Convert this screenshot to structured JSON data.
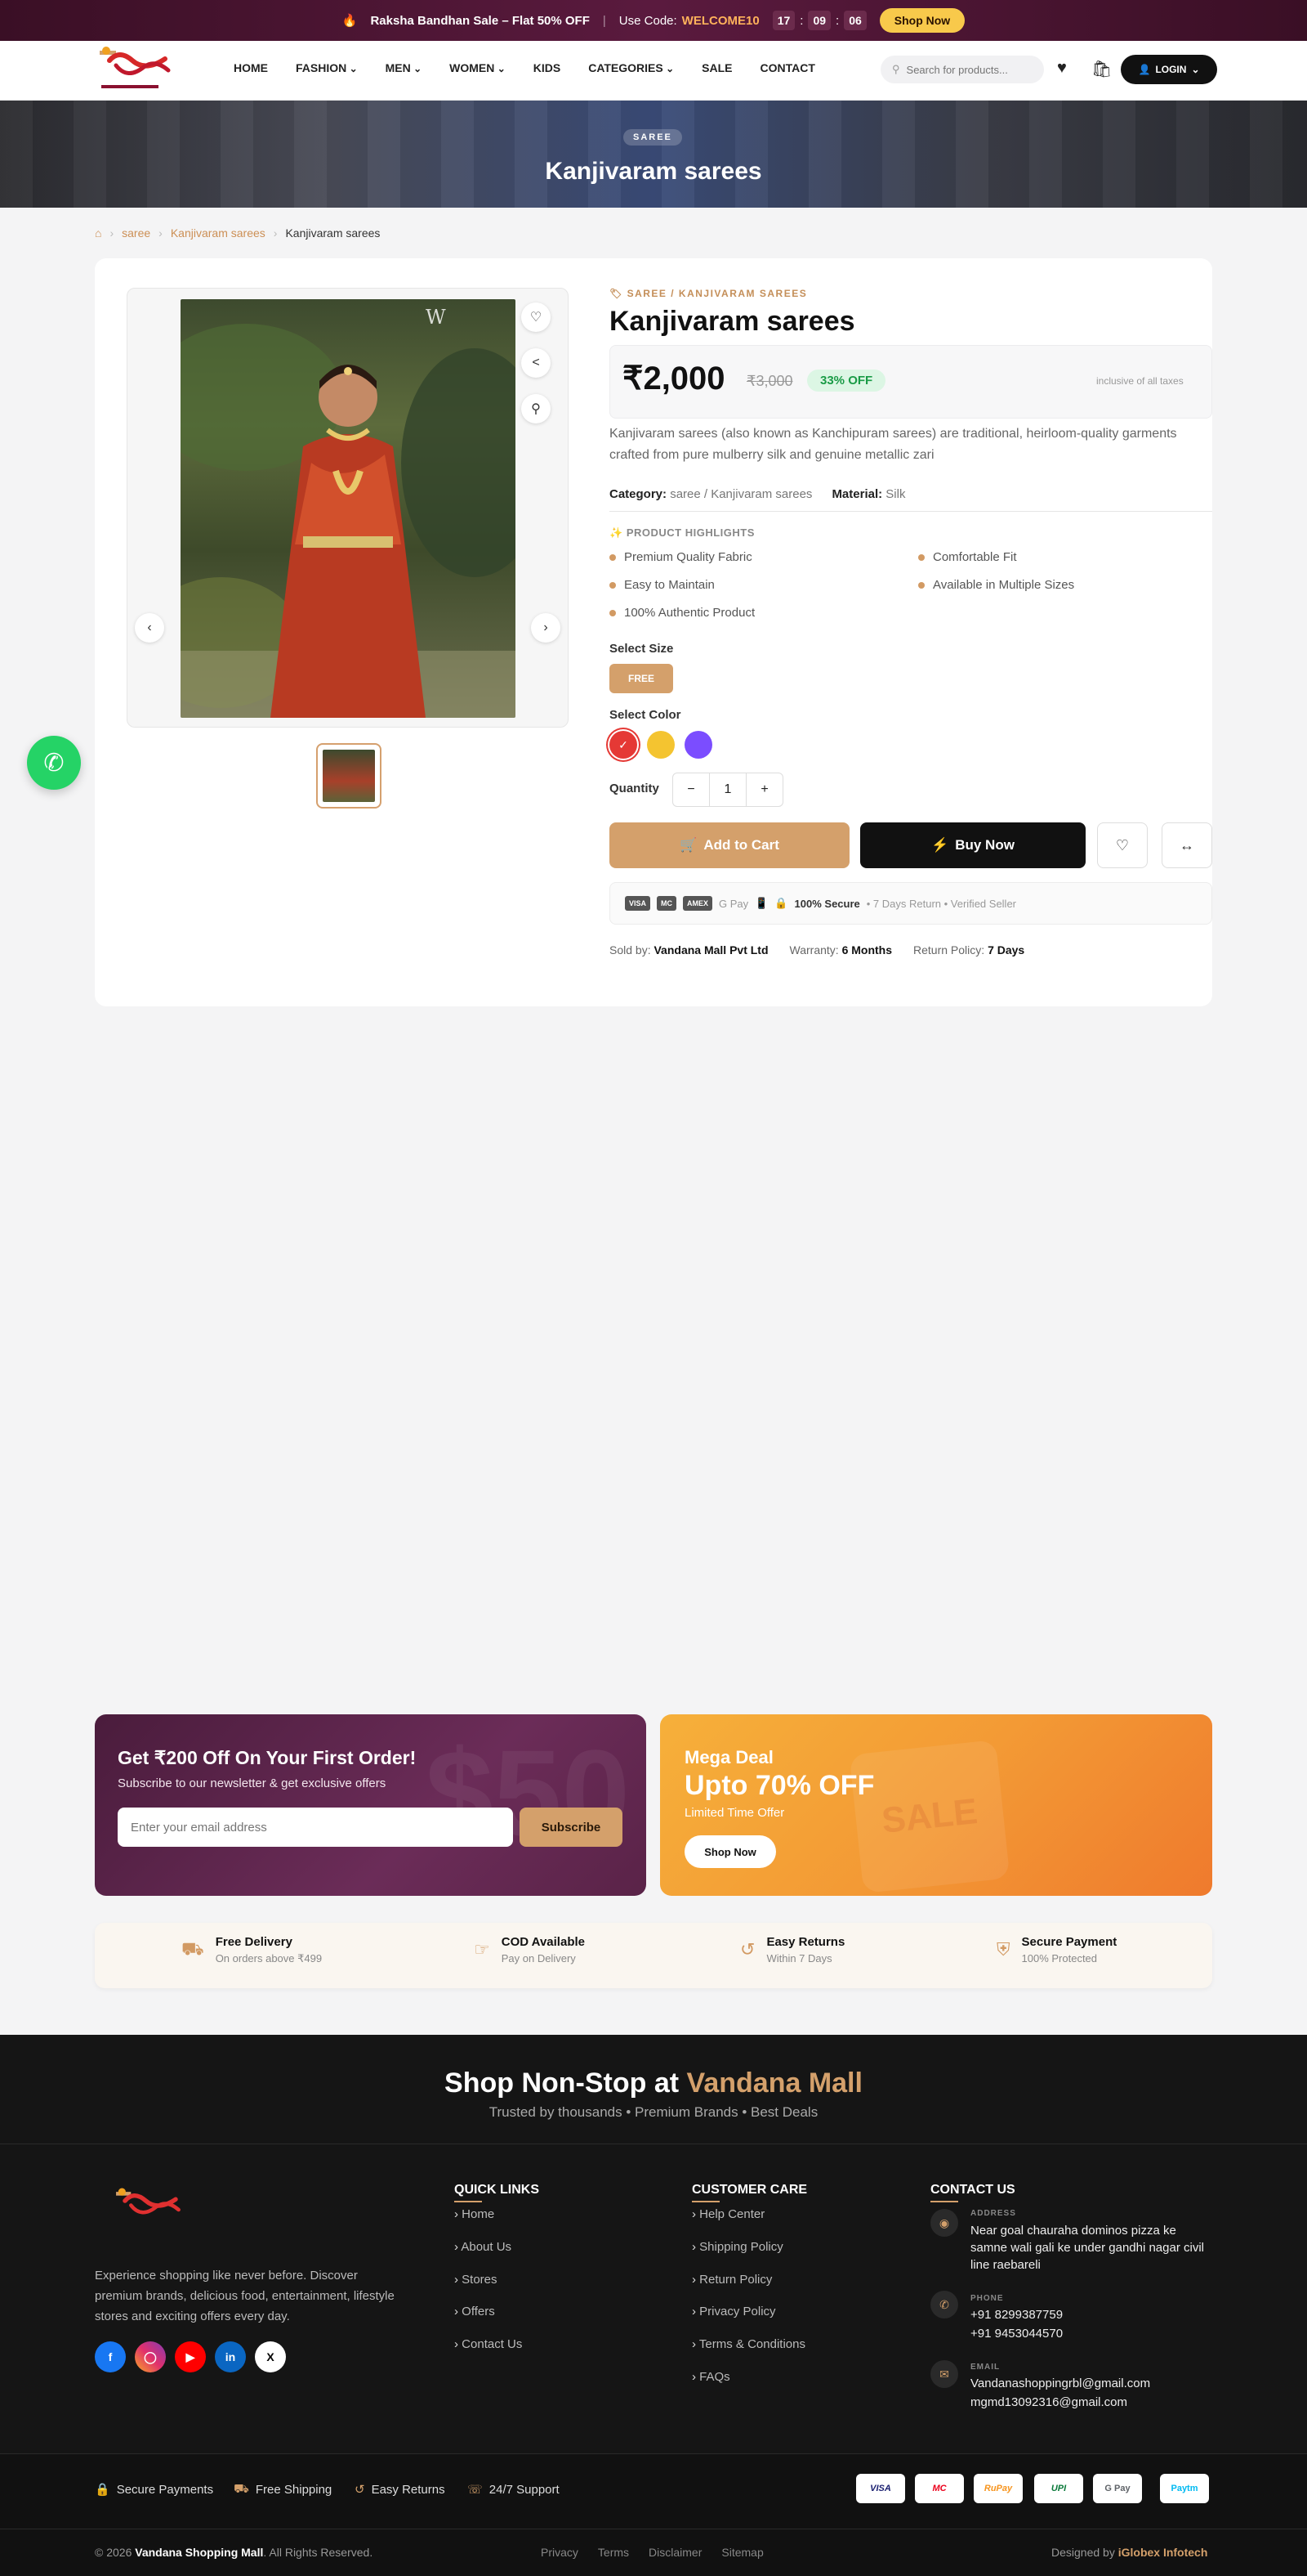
{
  "promo": {
    "text": "Raksha Bandhan Sale – Flat 50% OFF",
    "code_label": "Use Code:",
    "code": "WELCOME10",
    "timer": [
      "17",
      "09",
      "06"
    ],
    "shop_now": "Shop Now"
  },
  "header": {
    "nav": [
      "HOME",
      "FASHION",
      "MEN",
      "WOMEN",
      "KIDS",
      "CATEGORIES",
      "SALE",
      "CONTACT"
    ],
    "search_placeholder": "Search for products...",
    "login": "LOGIN"
  },
  "banner": {
    "tag": "SAREE",
    "title": "Kanjivaram sarees"
  },
  "breadcrumb": [
    "saree",
    "Kanjivaram sarees",
    "Kanjivaram sarees"
  ],
  "product": {
    "category_line": "SAREE / KANJIVARAM SAREES",
    "title": "Kanjivaram sarees",
    "price": "₹2,000",
    "old_price": "₹3,000",
    "discount": "33% OFF",
    "tax_note": "inclusive of all taxes",
    "description": "Kanjivaram sarees (also known as Kanchipuram sarees) are traditional, heirloom-quality garments crafted from pure mulberry silk and genuine metallic zari",
    "category_label": "Category:",
    "category_value": "saree / Kanjivaram sarees",
    "material_label": "Material:",
    "material_value": "Silk",
    "highlights_title": "PRODUCT HIGHLIGHTS",
    "highlights": [
      "Premium Quality Fabric",
      "Comfortable Fit",
      "Easy to Maintain",
      "Available in Multiple Sizes",
      "100% Authentic Product"
    ],
    "select_size_label": "Select Size",
    "size": "FREE",
    "select_color_label": "Select Color",
    "colors": [
      "#e53935",
      "#f4c430",
      "#7b4dff"
    ],
    "quantity_label": "Quantity",
    "quantity": "1",
    "add_to_cart": "Add to Cart",
    "buy_now": "Buy Now",
    "secure_label": "100% Secure",
    "secure_extra": "• 7 Days Return • Verified Seller",
    "pay_methods": [
      "VISA",
      "MC",
      "AMEX",
      "G Pay"
    ],
    "sold_by_label": "Sold by:",
    "sold_by": "Vandana Mall Pvt Ltd",
    "warranty_label": "Warranty:",
    "warranty": "6 Months",
    "return_label": "Return Policy:",
    "return": "7 Days"
  },
  "newsletter": {
    "title": "Get ₹200 Off On Your First Order!",
    "subtitle": "Subscribe to our newsletter & get exclusive offers",
    "placeholder": "Enter your email address",
    "button": "Subscribe"
  },
  "mega": {
    "title": "Mega Deal",
    "headline": "Upto 70% OFF",
    "sub": "Limited Time Offer",
    "button": "Shop Now",
    "watermark": "SALE"
  },
  "features": [
    {
      "title": "Free Delivery",
      "sub": "On orders above ₹499"
    },
    {
      "title": "COD Available",
      "sub": "Pay on Delivery"
    },
    {
      "title": "Easy Returns",
      "sub": "Within 7 Days"
    },
    {
      "title": "Secure Payment",
      "sub": "100% Protected"
    }
  ],
  "footer": {
    "headline_pre": "Shop Non-Stop at",
    "headline_brand": "Vandana Mall",
    "tagline": "Trusted by thousands • Premium Brands • Best Deals",
    "about": "Experience shopping like never before. Discover premium brands, delicious food, entertainment, lifestyle stores and exciting offers every day.",
    "quick_links_title": "QUICK LINKS",
    "quick_links": [
      "Home",
      "About Us",
      "Stores",
      "Offers",
      "Contact Us"
    ],
    "care_title": "CUSTOMER CARE",
    "care_links": [
      "Help Center",
      "Shipping Policy",
      "Return Policy",
      "Privacy Policy",
      "Terms & Conditions",
      "FAQs"
    ],
    "contact_title": "CONTACT US",
    "address_label": "ADDRESS",
    "address": "Near goal chauraha dominos pizza ke samne wali gali ke under gandhi nagar civil line raebareli",
    "phone_label": "PHONE",
    "phone1": "+91 8299387759",
    "phone2": "+91 9453044570",
    "email_label": "EMAIL",
    "email1": "Vandanashoppingrbl@gmail.com",
    "email2": "mgmd13092316@gmail.com",
    "badges": [
      "Secure Payments",
      "Free Shipping",
      "Easy Returns",
      "24/7 Support"
    ],
    "pay_cards": [
      "VISA",
      "MC",
      "RuPay",
      "UPI",
      "G Pay",
      "Paytm"
    ],
    "copyright_pre": "© 2026",
    "copyright_brand": "Vandana Shopping Mall",
    "copyright_post": ". All Rights Reserved.",
    "bottom_links": [
      "Privacy",
      "Terms",
      "Disclaimer",
      "Sitemap"
    ],
    "designed_pre": "Designed by",
    "designed_by": "iGlobex Infotech"
  },
  "colors": {
    "accent": "#d4a06b",
    "dark": "#111111",
    "promo_bg": "#3a0f25"
  }
}
